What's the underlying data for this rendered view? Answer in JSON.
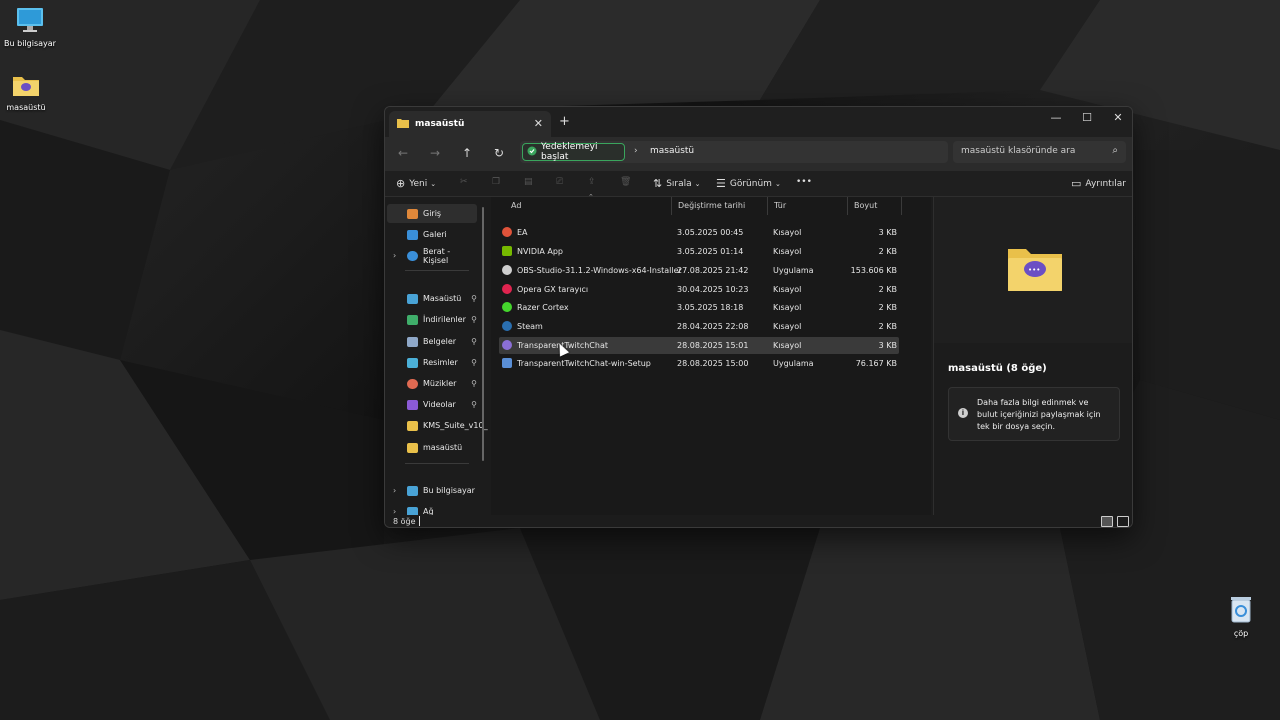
{
  "desktop": {
    "icons": [
      {
        "label": "Bu bilgisayar",
        "icon": "monitor-icon"
      },
      {
        "label": "masaüstü",
        "icon": "folder-icon"
      },
      {
        "label": "çöp",
        "icon": "recycle-bin-icon"
      }
    ]
  },
  "window": {
    "tab_title": "masaüstü",
    "tab_close": "✕",
    "new_tab": "+",
    "controls": {
      "minimize": "—",
      "maximize": "☐",
      "close": "✕"
    }
  },
  "address": {
    "back": "←",
    "forward": "→",
    "up": "↑",
    "refresh": "↻",
    "backup_label": "Yedeklemeyi başlat",
    "separator": "›",
    "crumb": "masaüstü",
    "search_placeholder": "masaüstü klasöründe ara",
    "search_icon": "⌕"
  },
  "toolbar": {
    "new_label": "Yeni",
    "sort_label": "Sırala",
    "view_label": "Görünüm",
    "more": "•••",
    "details_label": "Ayrıntılar"
  },
  "nav": {
    "items": [
      {
        "label": "Giriş",
        "icon": "home-icon",
        "color": "#e0883a"
      },
      {
        "label": "Galeri",
        "icon": "gallery-icon",
        "color": "#3a8fd9"
      },
      {
        "label": "Berat - Kişisel",
        "icon": "cloud-icon",
        "color": "#3a8fd9"
      },
      {
        "label": "Masaüstü",
        "icon": "desktop-icon",
        "color": "#49a3d6"
      },
      {
        "label": "İndirilenler",
        "icon": "download-icon",
        "color": "#3fae6a"
      },
      {
        "label": "Belgeler",
        "icon": "documents-icon",
        "color": "#8fa8c8"
      },
      {
        "label": "Resimler",
        "icon": "pictures-icon",
        "color": "#4bb0d8"
      },
      {
        "label": "Müzikler",
        "icon": "music-icon",
        "color": "#e06a52"
      },
      {
        "label": "Videolar",
        "icon": "videos-icon",
        "color": "#8b5ad6"
      },
      {
        "label": "KMS_Suite_v10_",
        "icon": "folder-icon",
        "color": "#e9c04a"
      },
      {
        "label": "masaüstü",
        "icon": "folder-icon",
        "color": "#e9c04a"
      },
      {
        "label": "Bu bilgisayar",
        "icon": "pc-icon",
        "color": "#49a3d6"
      },
      {
        "label": "Ağ",
        "icon": "network-icon",
        "color": "#49a3d6"
      }
    ],
    "pin": "📌",
    "chevron": "›"
  },
  "columns": {
    "name": "Ad",
    "date": "Değiştirme tarihi",
    "type": "Tür",
    "size": "Boyut"
  },
  "files": [
    {
      "name": "EA",
      "date": "3.05.2025 00:45",
      "type": "Kısayol",
      "size": "3 KB",
      "color": "#e0533a"
    },
    {
      "name": "NVIDIA App",
      "date": "3.05.2025 01:14",
      "type": "Kısayol",
      "size": "2 KB",
      "color": "#76b900"
    },
    {
      "name": "OBS-Studio-31.1.2-Windows-x64-Installer",
      "date": "27.08.2025 21:42",
      "type": "Uygulama",
      "size": "153.606 KB",
      "color": "#cfcfcf"
    },
    {
      "name": "Opera GX tarayıcı",
      "date": "30.04.2025 10:23",
      "type": "Kısayol",
      "size": "2 KB",
      "color": "#e0244f"
    },
    {
      "name": "Razer Cortex",
      "date": "3.05.2025 18:18",
      "type": "Kısayol",
      "size": "2 KB",
      "color": "#44d62c"
    },
    {
      "name": "Steam",
      "date": "28.04.2025 22:08",
      "type": "Kısayol",
      "size": "2 KB",
      "color": "#2a6fb0"
    },
    {
      "name": "TransparentTwitchChat",
      "date": "28.08.2025 15:01",
      "type": "Kısayol",
      "size": "3 KB",
      "color": "#8b6fd6"
    },
    {
      "name": "TransparentTwitchChat-win-Setup",
      "date": "28.08.2025 15:00",
      "type": "Uygulama",
      "size": "76.167 KB",
      "color": "#5a8fd6"
    }
  ],
  "details": {
    "title": "masaüstü (8 öğe)",
    "info_icon": "i",
    "info_text": "Daha fazla bilgi edinmek ve bulut içeriğinizi paylaşmak için tek bir dosya seçin."
  },
  "status": {
    "count": "8 öğe"
  }
}
